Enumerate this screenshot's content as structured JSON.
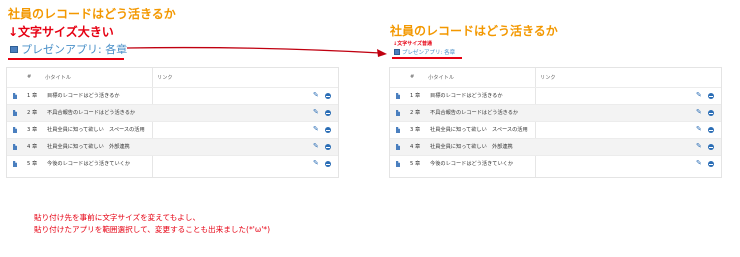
{
  "left": {
    "title": "社員のレコードはどう活きるか",
    "note": "↓文字サイズ大きい",
    "app_label": "プレゼンアプリ: 各章"
  },
  "right": {
    "title": "社員のレコードはどう活きるか",
    "note": "↓文字サイズ普通",
    "app_label": "プレゼンアプリ: 各章"
  },
  "table": {
    "headers": {
      "num": "#",
      "subtitle": "小タイトル",
      "link": "リンク"
    },
    "rows": [
      {
        "num": "1 章",
        "subtitle": "目標のレコードはどう活きるか"
      },
      {
        "num": "2 章",
        "subtitle": "不具合報告のレコードはどう活きるか"
      },
      {
        "num": "3 章",
        "subtitle": "社員全員に知って欲しい　スペースの活用"
      },
      {
        "num": "4 章",
        "subtitle": "社員全員に知って欲しい　外部連携"
      },
      {
        "num": "5 章",
        "subtitle": "今後のレコードはどう活きていくか"
      }
    ]
  },
  "footer_note": {
    "line1": "貼り付け先を事前に文字サイズを変えてもよし、",
    "line2": "貼り付けたアプリを範囲選択して、変更することも出来ました(*'ω'*)"
  },
  "colors": {
    "title": "#f39800",
    "note": "#e60012",
    "link": "#4a90c8",
    "icon": "#4a7fbf"
  }
}
